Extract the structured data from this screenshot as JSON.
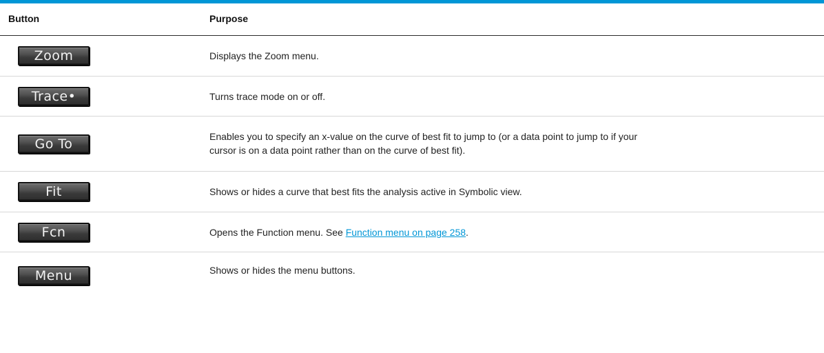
{
  "table": {
    "headers": {
      "button": "Button",
      "purpose": "Purpose"
    },
    "rows": [
      {
        "button_label": "Zoom",
        "purpose": "Displays the Zoom menu."
      },
      {
        "button_label": "Trace•",
        "purpose": "Turns trace mode on or off."
      },
      {
        "button_label": "Go To",
        "purpose_line1": "Enables you to specify an x-value on the curve of best fit to jump to (or a data point to jump to if your",
        "purpose_line2": "cursor is on a data point rather than on the curve of best fit)."
      },
      {
        "button_label": "Fit",
        "purpose": "Shows or hides a curve that best fits the analysis active in Symbolic view."
      },
      {
        "button_label": "Fcn",
        "purpose_prefix": "Opens the Function menu. See ",
        "purpose_link": "Function menu on page 258",
        "purpose_suffix": "."
      },
      {
        "button_label": "Menu",
        "purpose": "Shows or hides the menu buttons."
      }
    ]
  },
  "colors": {
    "accent_rule": "#0096d6",
    "link": "#0096d6",
    "button_face": "#3a3a3a",
    "button_text": "#f2f2f2"
  }
}
